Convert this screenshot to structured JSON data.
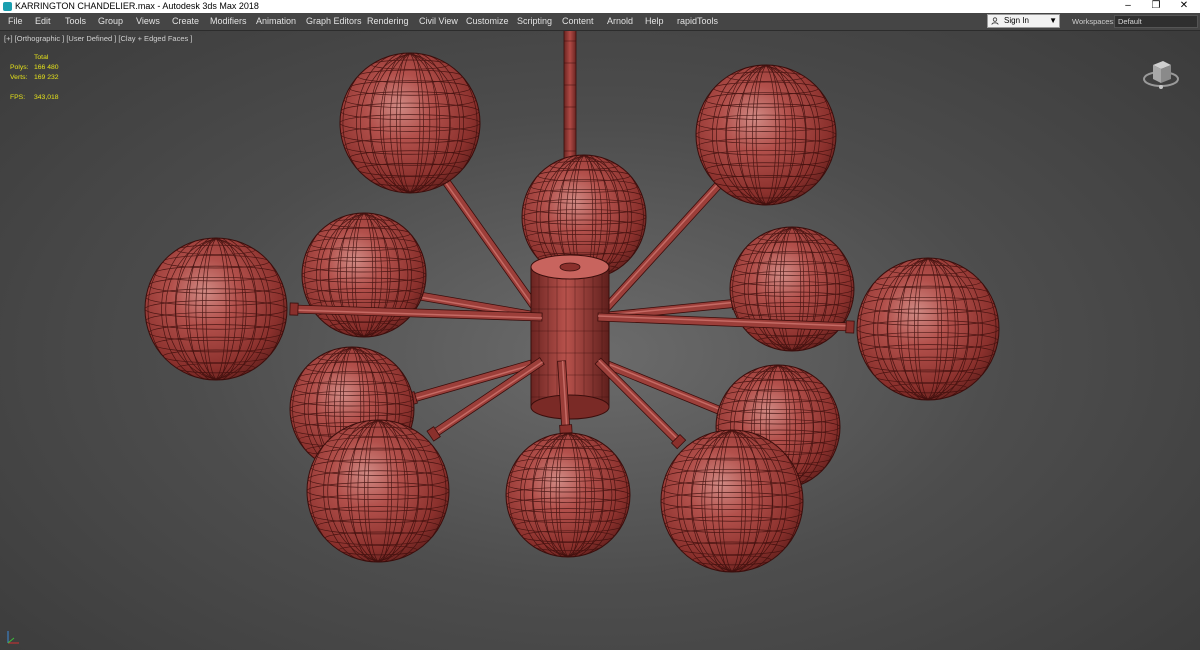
{
  "window": {
    "title": "KARRINGTON CHANDELIER.max - Autodesk 3ds Max 2018",
    "controls": {
      "minimize": "–",
      "restore": "❐",
      "close": "✕"
    }
  },
  "menubar": {
    "items": [
      "File",
      "Edit",
      "Tools",
      "Group",
      "Views",
      "Create",
      "Modifiers",
      "Animation",
      "Graph Editors",
      "Rendering",
      "Civil View",
      "Customize",
      "Scripting",
      "Content",
      "Arnold",
      "Help",
      "rapidTools"
    ]
  },
  "account": {
    "signin_label": "Sign In",
    "workspaces_label": "Workspaces:",
    "workspace_value": "Default"
  },
  "viewport": {
    "label": "[+] [Orthographic ] [User Defined ] [Clay + Edged Faces ]",
    "stats": {
      "header": "Total",
      "polys_label": "Polys:",
      "polys_value": "166 480",
      "verts_label": "Verts:",
      "verts_value": "169 232",
      "fps_label": "FPS:",
      "fps_value": "343,018"
    }
  },
  "colors": {
    "clay": "#b04a45",
    "clay_dark": "#5e1f1c",
    "wire": "#3b0e0c",
    "stats_text": "#e6e31a"
  },
  "icons": [
    "app-icon",
    "user-icon",
    "chevron-down-icon",
    "viewcube-icon",
    "axis-tripod-icon"
  ]
}
